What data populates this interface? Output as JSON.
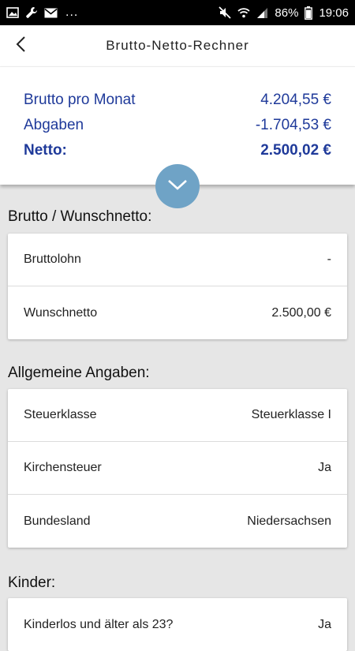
{
  "status_bar": {
    "ellipsis": "...",
    "battery": "86%",
    "time": "19:06",
    "icons": [
      "image-icon",
      "wrench-icon",
      "mail-icon",
      "mute-icon",
      "wifi-icon",
      "signal-icon",
      "battery-icon"
    ]
  },
  "app_bar": {
    "title": "Brutto-Netto-Rechner",
    "back_icon": "chevron-left-icon"
  },
  "summary": {
    "brutto_label": "Brutto pro Monat",
    "brutto_value": "4.204,55 €",
    "abgaben_label": "Abgaben",
    "abgaben_value": "-1.704,53 €",
    "netto_label": "Netto:",
    "netto_value": "2.500,02 €",
    "text_color": "#1f3a9a",
    "expand_icon": "chevron-down-icon",
    "expand_color": "#6fa3c6"
  },
  "sections": {
    "brutto": {
      "title": "Brutto / Wunschnetto:",
      "rows": [
        {
          "label": "Bruttolohn",
          "value": "-"
        },
        {
          "label": "Wunschnetto",
          "value": "2.500,00 €"
        }
      ]
    },
    "allgemein": {
      "title": "Allgemeine Angaben:",
      "rows": [
        {
          "label": "Steuerklasse",
          "value": "Steuerklasse I"
        },
        {
          "label": "Kirchensteuer",
          "value": "Ja"
        },
        {
          "label": "Bundesland",
          "value": "Niedersachsen"
        }
      ]
    },
    "kinder": {
      "title": "Kinder:",
      "rows": [
        {
          "label": "Kinderlos und älter als 23?",
          "value": "Ja"
        }
      ]
    }
  }
}
